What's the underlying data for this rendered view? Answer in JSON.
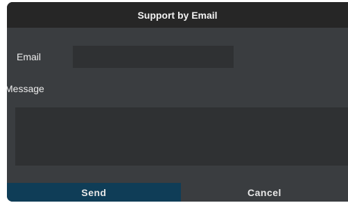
{
  "dialog": {
    "title": "Support by Email"
  },
  "form": {
    "email_label": "Email",
    "email_value": "",
    "message_label": "Message",
    "message_value": ""
  },
  "buttons": {
    "send_label": "Send",
    "cancel_label": "Cancel"
  },
  "colors": {
    "title_bar": "#262626",
    "dialog_bg": "#3a3d40",
    "input_bg": "#2f3133",
    "send_bg": "#0f3d57"
  }
}
